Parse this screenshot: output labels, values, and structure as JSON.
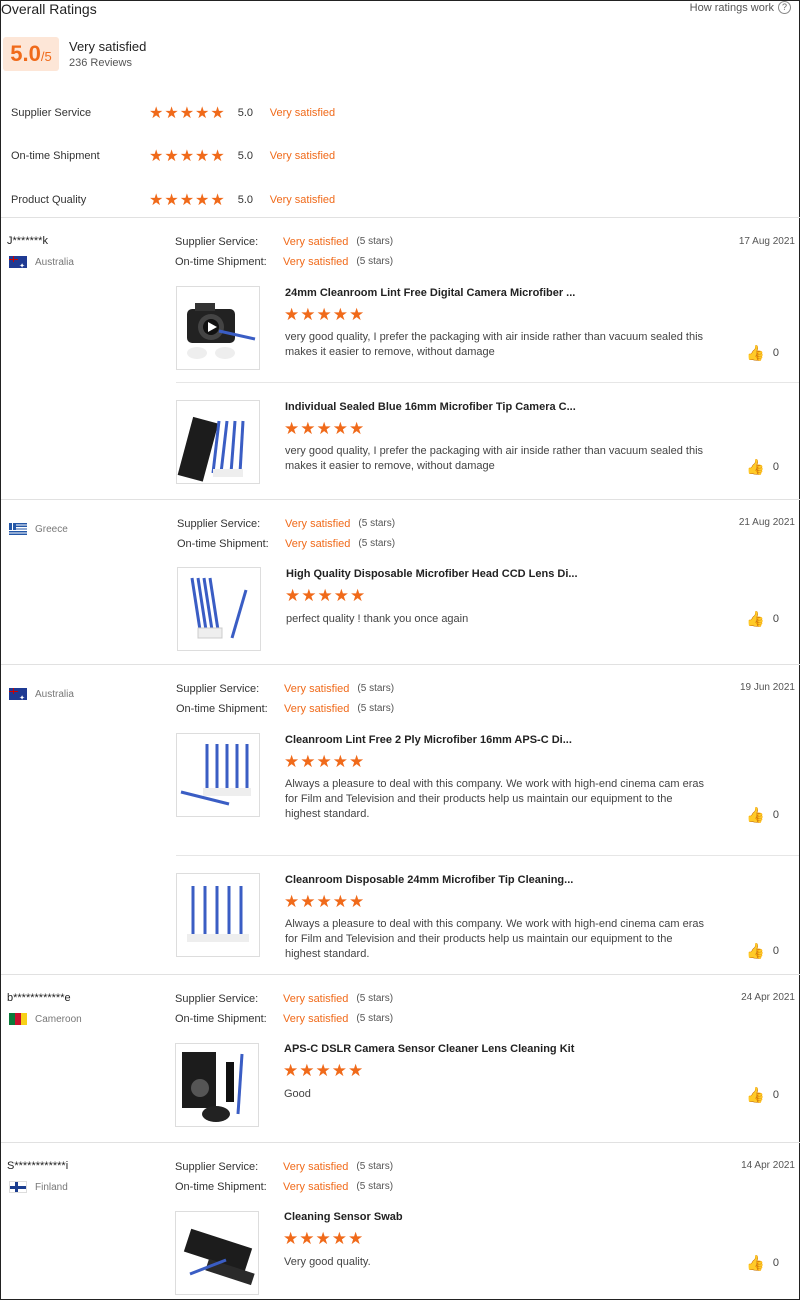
{
  "header": {
    "title": "Overall Ratings",
    "how_link": "How ratings work",
    "score": "5.0",
    "score_den": "/5",
    "overall_label": "Very satisfied",
    "review_count": "236 Reviews"
  },
  "categories": [
    {
      "label": "Supplier Service",
      "score": "5.0",
      "text": "Very satisfied"
    },
    {
      "label": "On-time Shipment",
      "score": "5.0",
      "text": "Very satisfied"
    },
    {
      "label": "Product Quality",
      "score": "5.0",
      "text": "Very satisfied"
    }
  ],
  "stars": "★★★★★",
  "thumb_icon": "👍",
  "labels": {
    "supplier_service": "Supplier Service:",
    "ontime_shipment": "On-time Shipment:"
  },
  "reviews": [
    {
      "user": "J*******k",
      "country": "Australia",
      "date": "17 Aug 2021",
      "supplier": "Very satisfied",
      "supplier_stars": "(5 stars)",
      "shipment": "Very satisfied",
      "shipment_stars": "(5 stars)",
      "items": [
        {
          "title": "24mm Cleanroom Lint Free Digital Camera Microfiber ...",
          "text": "very good quality, I prefer the packaging with air inside rather than vacuum sealed this makes it easier to remove, without damage",
          "likes": "0"
        },
        {
          "title": "Individual Sealed Blue 16mm Microfiber Tip Camera C...",
          "text": "very good quality, I prefer the packaging with air inside rather than vacuum sealed this makes it easier to remove, without damage",
          "likes": "0"
        }
      ]
    },
    {
      "user": "",
      "country": "Greece",
      "date": "21 Aug 2021",
      "supplier": "Very satisfied",
      "supplier_stars": "(5 stars)",
      "shipment": "Very satisfied",
      "shipment_stars": "(5 stars)",
      "items": [
        {
          "title": "High Quality Disposable Microfiber Head CCD Lens Di...",
          "text": "perfect quality ! thank you once again",
          "likes": "0"
        }
      ]
    },
    {
      "user": "",
      "country": "Australia",
      "date": "19 Jun 2021",
      "supplier": "Very satisfied",
      "supplier_stars": "(5 stars)",
      "shipment": "Very satisfied",
      "shipment_stars": "(5 stars)",
      "items": [
        {
          "title": "Cleanroom Lint Free 2 Ply Microfiber 16mm APS-C Di...",
          "text": "Always a pleasure to deal with this company. We work with high-end cinema cam eras for Film and Television and their products help us maintain our equipment to the highest standard.",
          "likes": "0"
        },
        {
          "title": "Cleanroom Disposable 24mm Microfiber Tip Cleaning...",
          "text": "Always a pleasure to deal with this company. We work with high-end cinema cam eras for Film and Television and their products help us maintain our equipment to the highest standard.",
          "likes": "0"
        }
      ]
    },
    {
      "user": "b************e",
      "country": "Cameroon",
      "date": "24 Apr 2021",
      "supplier": "Very satisfied",
      "supplier_stars": "(5 stars)",
      "shipment": "Very satisfied",
      "shipment_stars": "(5 stars)",
      "items": [
        {
          "title": "APS-C DSLR Camera Sensor Cleaner Lens Cleaning Kit",
          "text": "Good",
          "likes": "0"
        }
      ]
    },
    {
      "user": "S************i",
      "country": "Finland",
      "date": "14 Apr 2021",
      "supplier": "Very satisfied",
      "supplier_stars": "(5 stars)",
      "shipment": "Very satisfied",
      "shipment_stars": "(5 stars)",
      "items": [
        {
          "title": "Cleaning Sensor Swab",
          "text": "Very good quality.",
          "likes": "0"
        }
      ]
    }
  ]
}
